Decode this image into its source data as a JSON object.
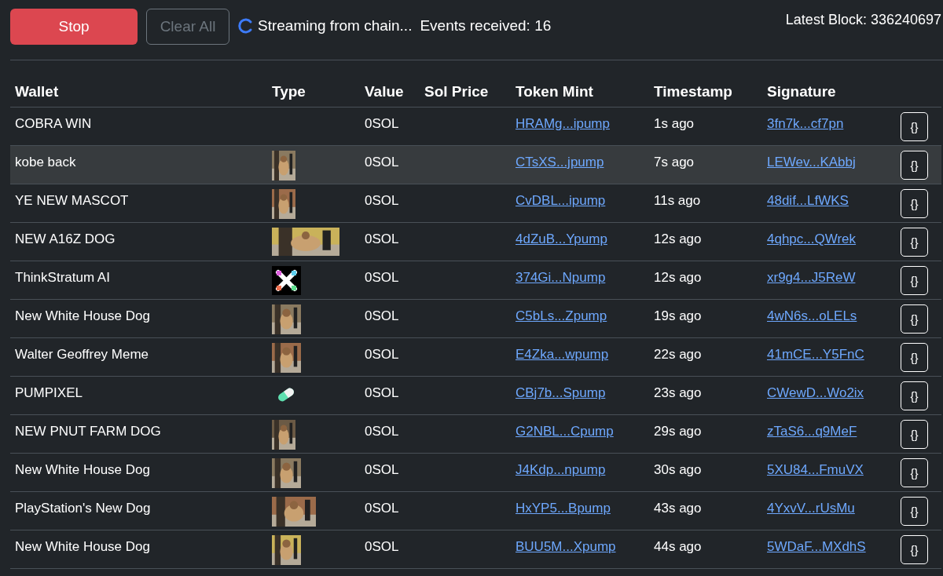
{
  "toolbar": {
    "stop_button": "Stop",
    "clear_button": {
      "label": "Clear All",
      "disabled": true
    },
    "streaming": true,
    "status": "Streaming from chain...",
    "events": "Events received: 16",
    "latest_block": "Latest Block: 336240697"
  },
  "table": {
    "columns": [
      "Wallet",
      "Type",
      "Value",
      "Sol Price",
      "Token Mint",
      "Timestamp",
      "Signature"
    ],
    "rows": [
      {
        "wallet": "COBRA WIN",
        "kind": "none",
        "value": "0SOL",
        "mint": "HRAMg...ipump",
        "time": "1s ago",
        "signature": "3fn7k...cf7pn",
        "json_button": "{}",
        "highlighted": false
      },
      {
        "wallet": "kobe back",
        "kind": "tall",
        "value": "0SOL",
        "mint": "CTsXS...jpump",
        "time": "7s ago",
        "signature": "LEWev...KAbbj",
        "json_button": "{}",
        "highlighted": true
      },
      {
        "wallet": "YE NEW MASCOT",
        "kind": "tall",
        "value": "0SOL",
        "mint": "CvDBL...ipump",
        "time": "11s ago",
        "signature": "48dif...LfWKS",
        "json_button": "{}",
        "highlighted": false
      },
      {
        "wallet": "NEW A16Z DOG",
        "kind": "banner",
        "value": "0SOL",
        "mint": "4dZuB...Ypump",
        "time": "12s ago",
        "signature": "4qhpc...QWrek",
        "json_button": "{}",
        "highlighted": false
      },
      {
        "wallet": "ThinkStratum AI",
        "kind": "logo",
        "value": "0SOL",
        "mint": "374Gi...Npump",
        "time": "12s ago",
        "signature": "xr9g4...J5ReW",
        "json_button": "{}",
        "highlighted": false
      },
      {
        "wallet": "New White House Dog",
        "kind": "square",
        "value": "0SOL",
        "mint": "C5bLs...Zpump",
        "time": "19s ago",
        "signature": "4wN6s...oLELs",
        "json_button": "{}",
        "highlighted": false
      },
      {
        "wallet": "Walter Geoffrey Meme",
        "kind": "square",
        "value": "0SOL",
        "mint": "E4Zka...wpump",
        "time": "22s ago",
        "signature": "41mCE...Y5FnC",
        "json_button": "{}",
        "highlighted": false
      },
      {
        "wallet": "PUMPIXEL",
        "kind": "pill",
        "value": "0SOL",
        "mint": "CBj7b...Spump",
        "time": "23s ago",
        "signature": "CWewD...Wo2ix",
        "json_button": "{}",
        "highlighted": false
      },
      {
        "wallet": "NEW PNUT FARM DOG",
        "kind": "tall",
        "value": "0SOL",
        "mint": "G2NBL...Cpump",
        "time": "29s ago",
        "signature": "zTaS6...q9MeF",
        "json_button": "{}",
        "highlighted": false
      },
      {
        "wallet": "New White House Dog",
        "kind": "square",
        "value": "0SOL",
        "mint": "J4Kdp...npump",
        "time": "30s ago",
        "signature": "5XU84...FmuVX",
        "json_button": "{}",
        "highlighted": false
      },
      {
        "wallet": "PlayStation's New Dog",
        "kind": "wide",
        "value": "0SOL",
        "mint": "HxYP5...Bpump",
        "time": "43s ago",
        "signature": "4YxvV...rUsMu",
        "json_button": "{}",
        "highlighted": false
      },
      {
        "wallet": "New White House Dog",
        "kind": "square",
        "value": "0SOL",
        "mint": "BUU5M...Xpump",
        "time": "44s ago",
        "signature": "5WDaF...MXdhS",
        "json_button": "{}",
        "highlighted": false
      }
    ]
  }
}
